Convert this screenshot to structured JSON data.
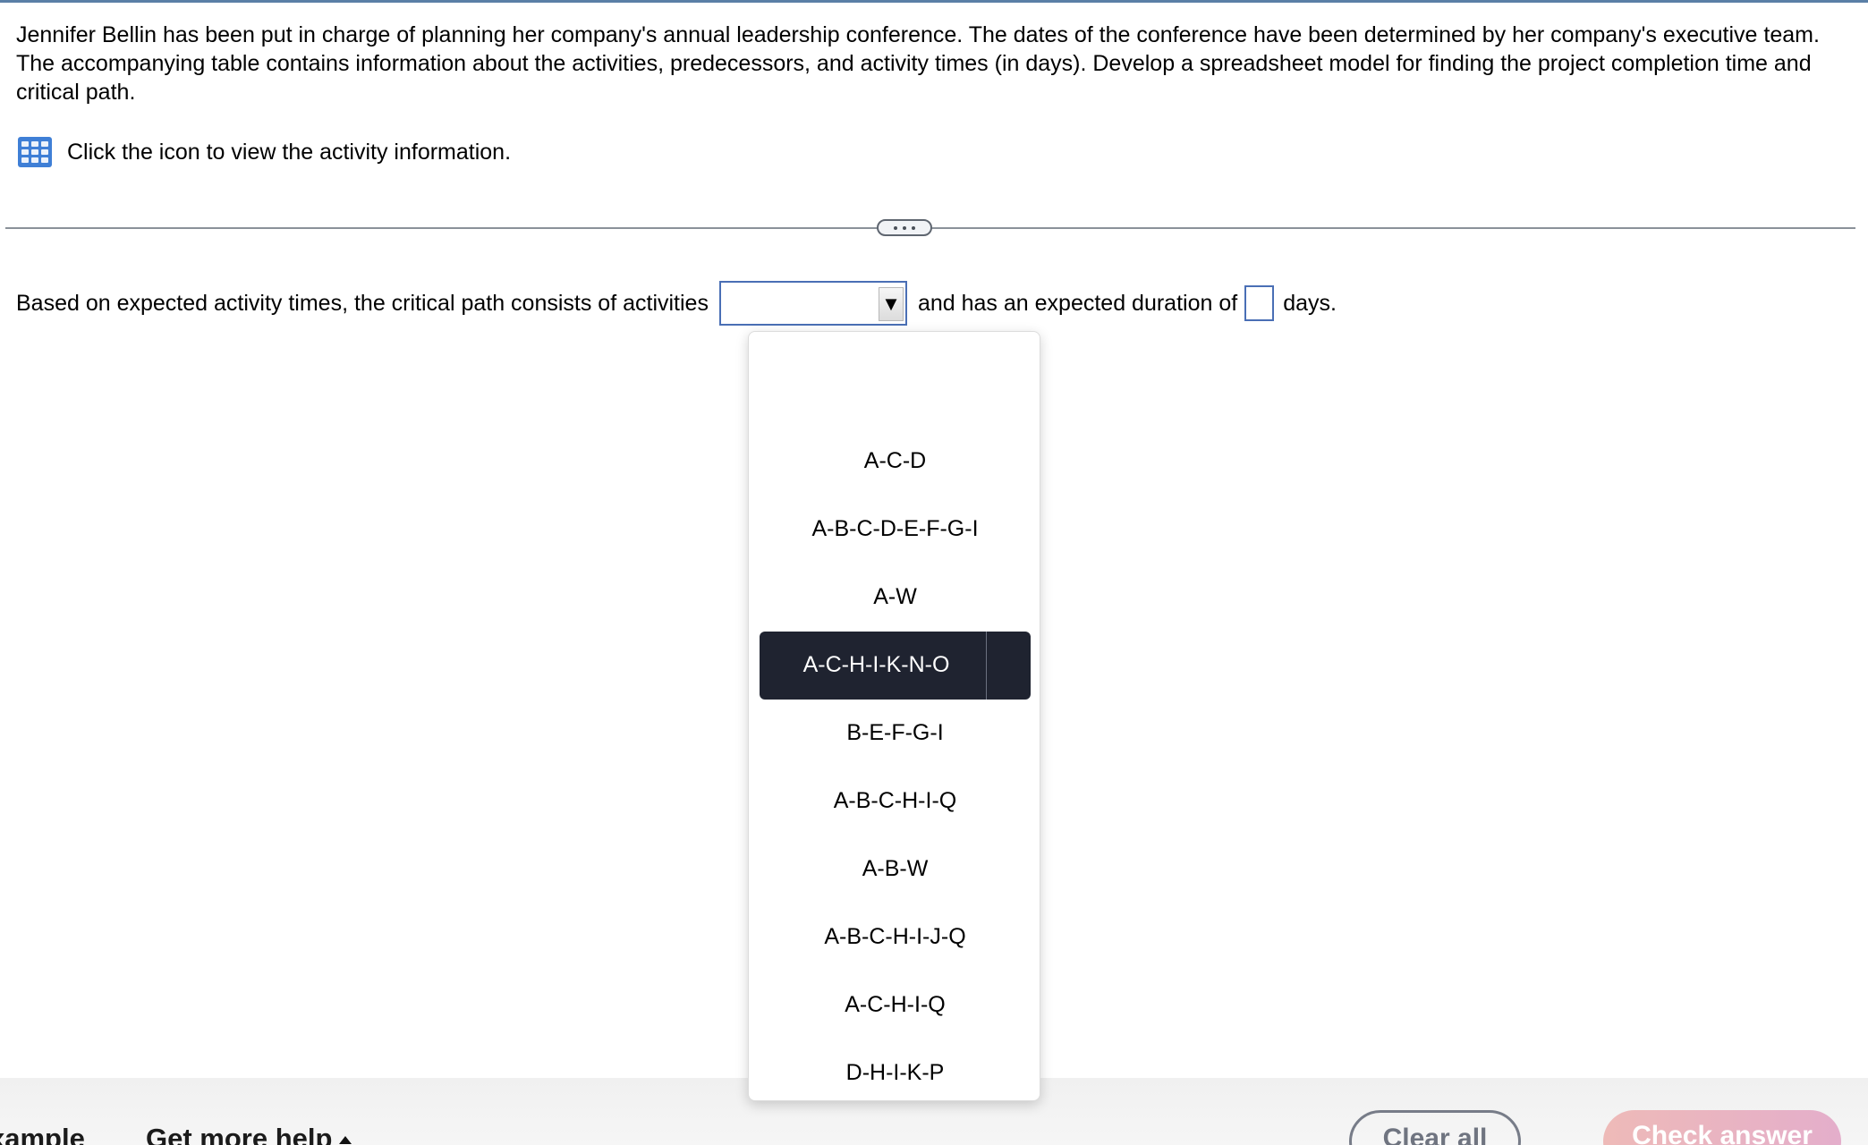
{
  "problem": {
    "text": "Jennifer Bellin has been put in charge of planning her company's annual leadership conference. The dates of the conference have been determined by her company's executive team. The accompanying table contains information about the activities, predecessors, and activity times (in days). Develop a spreadsheet model for finding the project completion time and critical path.",
    "info_icon": "table-grid-icon",
    "info_text": "Click the icon to view the activity information."
  },
  "divider": {
    "expand_icon": "ellipsis-icon"
  },
  "question": {
    "prefix": "Based on expected activity times, the critical path consists of activities",
    "select_value": "",
    "select_arrow": "▼",
    "middle": "and has an expected duration of",
    "duration_value": "",
    "suffix": "days."
  },
  "dropdown": {
    "options": [
      {
        "label": "",
        "selected": false
      },
      {
        "label": "A-C-D",
        "selected": false
      },
      {
        "label": "A-B-C-D-E-F-G-I",
        "selected": false
      },
      {
        "label": "A-W",
        "selected": false
      },
      {
        "label": "A-C-H-I-K-N-O",
        "selected": true
      },
      {
        "label": "B-E-F-G-I",
        "selected": false
      },
      {
        "label": "A-B-C-H-I-Q",
        "selected": false
      },
      {
        "label": "A-B-W",
        "selected": false
      },
      {
        "label": "A-B-C-H-I-J-Q",
        "selected": false
      },
      {
        "label": "A-C-H-I-Q",
        "selected": false
      },
      {
        "label": "D-H-I-K-P",
        "selected": false
      }
    ]
  },
  "bottom_bar": {
    "example_label": "xample",
    "help_label": "Get more help",
    "clear_label": "Clear all",
    "check_label": "Check answer"
  },
  "colors": {
    "accent_border": "#4a6fb5",
    "selected_option_bg": "#1f2330",
    "check_button_gradient": [
      "#eebab8",
      "#e4aecb"
    ]
  }
}
